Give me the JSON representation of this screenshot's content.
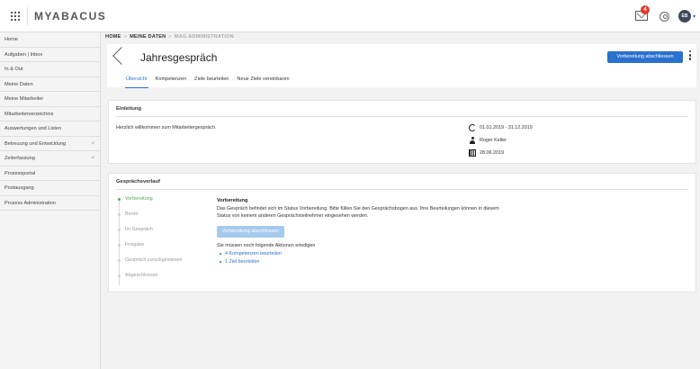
{
  "app": {
    "logo": "MYABACUS"
  },
  "header_icons": {
    "grid": "apps-grid-icon",
    "mail": "mail-icon",
    "mail_badge": "4",
    "user": "user-circle-icon",
    "avatar_initials": "EB",
    "avatar_caret": "▾"
  },
  "sidebar": {
    "items": [
      {
        "label": "Home",
        "chev": ""
      },
      {
        "label": "Aufgaben | Inbox",
        "chev": ""
      },
      {
        "label": "In & Out",
        "chev": ""
      },
      {
        "label": "Meine Daten",
        "chev": ""
      },
      {
        "label": "Meine Mitarbeiter",
        "chev": ""
      },
      {
        "label": "Mitarbeiterverzeichnis",
        "chev": ""
      },
      {
        "label": "Auswertungen und Listen",
        "chev": ""
      },
      {
        "label": "Betreuung und Entwicklung",
        "chev": "<"
      },
      {
        "label": "Zeiterfassung",
        "chev": "<"
      },
      {
        "label": "Prozessportal",
        "chev": ""
      },
      {
        "label": "Postausgang",
        "chev": ""
      },
      {
        "label": "Prozess Administration",
        "chev": ""
      }
    ]
  },
  "breadcrumb": {
    "home": "HOME",
    "sep": ">",
    "data": "MEINE DATEN",
    "muted": "MAG ADMINISTRATION"
  },
  "page": {
    "title": "Jahresgespräch",
    "primary_button": "Vorbereitung abschliessen",
    "tabs": [
      {
        "label": "Übersicht"
      },
      {
        "label": "Kompetenzen"
      },
      {
        "label": "Ziele beurteilen"
      },
      {
        "label": "Neue Ziele vereinbaren"
      }
    ]
  },
  "intro": {
    "title": "Einleitung",
    "welcome": "Herzlich willkommen zum Mitarbeitergespräch.",
    "period": "01.01.2019 - 31.12.2019",
    "person": "Roger Keller",
    "date": "28.06.2019"
  },
  "process": {
    "title": "Gesprächsverlauf",
    "steps": [
      {
        "label": "Vorbereitung"
      },
      {
        "label": "Bereit"
      },
      {
        "label": "Im Gespräch"
      },
      {
        "label": "Freigabe"
      },
      {
        "label": "Gespräch zurückgewiesen"
      },
      {
        "label": "Abgeschlossen"
      }
    ],
    "status_title": "Vorbereitung",
    "status_text": "Das Gespräch befindet sich im Status Vorbereitung. Bitte füllen Sie den Gesprächsbogen aus. Ihre Beurteilungen können in diesem Status von keinem anderen Gesprächsteilnehmer eingesehen werden.",
    "button": "Vorbereitung abschliessen",
    "actions_label": "Sie müssen noch folgende Aktionen erledigen",
    "actions": [
      {
        "label": "4 Kompetenzen beurteilen"
      },
      {
        "label": "1 Ziel beurteilen"
      }
    ]
  }
}
